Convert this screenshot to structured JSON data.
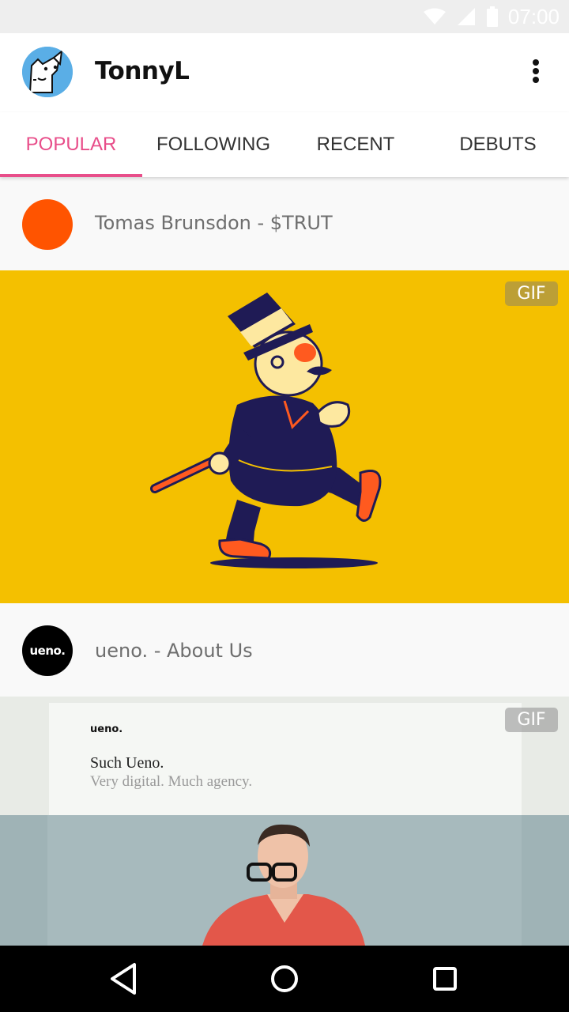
{
  "status_bar": {
    "time": "07:00",
    "icons": [
      "wifi-icon",
      "signal-icon",
      "battery-icon"
    ]
  },
  "app_bar": {
    "title": "TonnyL",
    "avatar": "dog-avatar-icon",
    "menu_icon": "more-vert-icon"
  },
  "tabs": [
    {
      "label": "POPULAR",
      "active": true
    },
    {
      "label": "FOLLOWING",
      "active": false
    },
    {
      "label": "RECENT",
      "active": false
    },
    {
      "label": "DEBUTS",
      "active": false
    }
  ],
  "shots": [
    {
      "title": "Tomas Brunsdon - $TRUT",
      "avatar_color": "#ff5400",
      "badge": "GIF",
      "image_bg": "#f4c000"
    },
    {
      "title": "ueno. - About Us",
      "avatar_text": "ueno.",
      "avatar_color": "#000000",
      "badge": "GIF",
      "image_bg": "#eef0ec",
      "preview": {
        "brand": "ueno.",
        "headline": "Such Ueno.",
        "tagline": "Very digital. Much agency."
      }
    }
  ],
  "colors": {
    "accent": "#e84e8a"
  },
  "nav_bar": {
    "buttons": [
      "back-icon",
      "home-icon",
      "recents-icon"
    ]
  }
}
